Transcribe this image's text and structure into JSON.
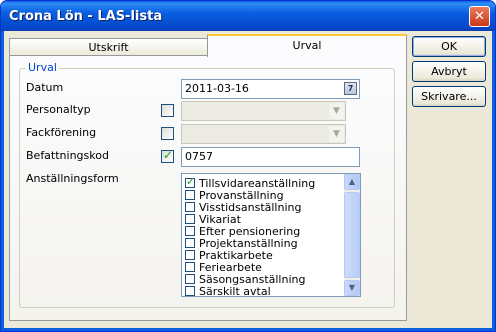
{
  "window": {
    "title": "Crona Lön - LAS-lista",
    "close_glyph": "✕"
  },
  "tabs": [
    {
      "label": "Utskrift",
      "active": false
    },
    {
      "label": "Urval",
      "active": true
    }
  ],
  "group": {
    "label": "Urval"
  },
  "form": {
    "datum": {
      "label": "Datum",
      "value": "2011-03-16",
      "calendar_icon_text": "7"
    },
    "personaltyp": {
      "label": "Personaltyp",
      "checked": false,
      "value": ""
    },
    "fackforening": {
      "label": "Fackförening",
      "checked": false,
      "value": ""
    },
    "befattningskod": {
      "label": "Befattningskod",
      "checked": true,
      "value": "0757"
    },
    "anstallningsform": {
      "label": "Anställningsform",
      "items": [
        {
          "label": "Tillsvidareanställning",
          "checked": true
        },
        {
          "label": "Provanställning",
          "checked": false
        },
        {
          "label": "Visstidsanställning",
          "checked": false
        },
        {
          "label": "Vikariat",
          "checked": false
        },
        {
          "label": "Efter pensionering",
          "checked": false
        },
        {
          "label": "Projektanställning",
          "checked": false
        },
        {
          "label": "Praktikarbete",
          "checked": false
        },
        {
          "label": "Feriearbete",
          "checked": false
        },
        {
          "label": "Säsongsanställning",
          "checked": false
        },
        {
          "label": "Särskilt avtal",
          "checked": false
        }
      ]
    }
  },
  "buttons": {
    "ok": "OK",
    "cancel": "Avbryt",
    "printer": "Skrivare..."
  },
  "colors": {
    "title_bar": "#0a5ee0",
    "group_label": "#0046d5",
    "check": "#21a121",
    "active_tab_highlight": "#ffc83c"
  }
}
